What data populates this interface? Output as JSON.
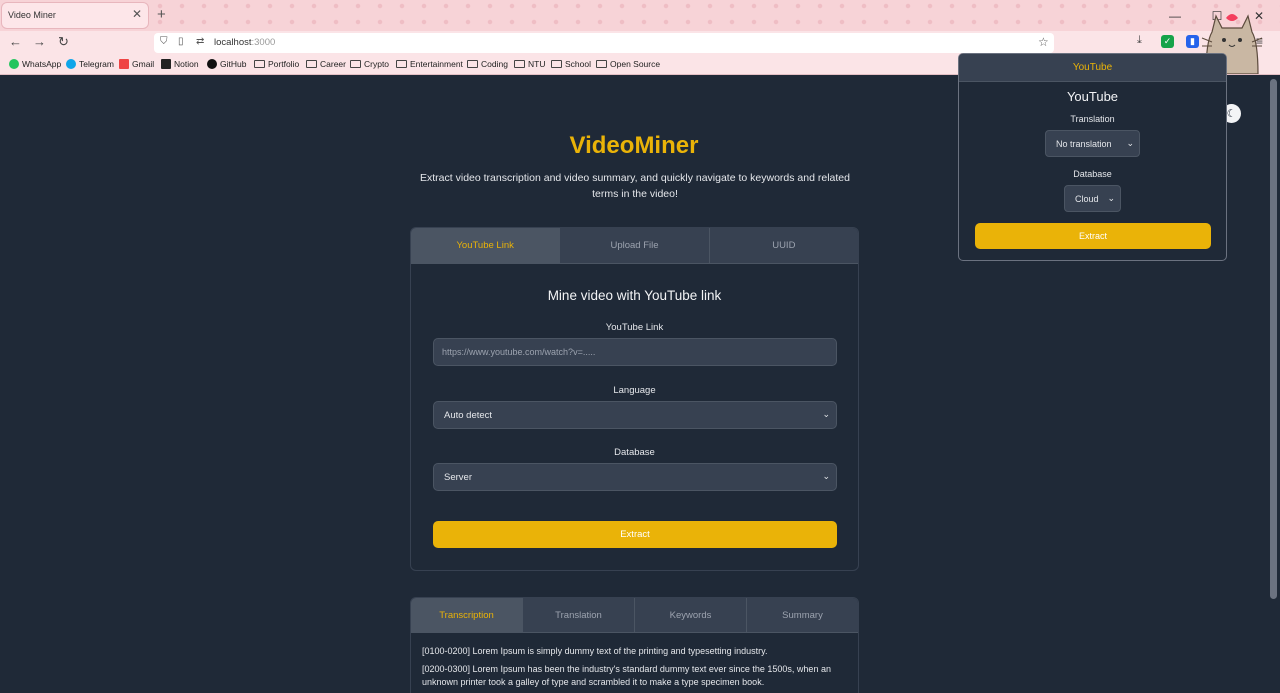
{
  "browser": {
    "tab_title": "Video Miner",
    "tab_close": "✕",
    "new_tab": "+",
    "url_host": "localhost",
    "url_port": ":3000",
    "bookmarks": [
      "WhatsApp",
      "Telegram",
      "Gmail",
      "Notion",
      "GitHub",
      "Portfolio",
      "Career",
      "Crypto",
      "Entertainment",
      "Coding",
      "NTU",
      "School",
      "Open Source"
    ]
  },
  "page": {
    "title": "VideoMiner",
    "subtitle": "Extract video transcription and video summary, and quickly navigate to keywords and related terms in the video!",
    "tabs": [
      "YouTube Link",
      "Upload File",
      "UUID"
    ],
    "active_tab": "YouTube Link",
    "form": {
      "heading": "Mine video with YouTube link",
      "link_label": "YouTube Link",
      "link_placeholder": "https://www.youtube.com/watch?v=.....",
      "language_label": "Language",
      "language_value": "Auto detect",
      "database_label": "Database",
      "database_value": "Server",
      "extract_label": "Extract"
    },
    "result_tabs": [
      "Transcription",
      "Translation",
      "Keywords",
      "Summary"
    ],
    "active_result_tab": "Transcription",
    "transcript": [
      "[0100-0200] Lorem Ipsum is simply dummy text of the printing and typesetting industry.",
      "[0200-0300] Lorem Ipsum has been the industry's standard dummy text ever since the 1500s, when an unknown printer took a galley of type and scrambled it to make a type specimen book."
    ]
  },
  "popup": {
    "header": "YouTube",
    "title": "YouTube",
    "translation_label": "Translation",
    "translation_value": "No translation",
    "database_label": "Database",
    "database_value": "Cloud",
    "extract_label": "Extract"
  },
  "colors": {
    "accent": "#eab308",
    "background": "#1f2937",
    "surface": "#374151",
    "tabbar": "#f7d3d7"
  },
  "icons": [
    "back-arrow-icon",
    "forward-arrow-icon",
    "reload-icon",
    "shield-icon",
    "page-icon",
    "star-icon",
    "download-icon",
    "extension-icon",
    "overflow-icon",
    "menu-icon",
    "folder-icon",
    "moon-icon",
    "cat-mascot-icon"
  ]
}
